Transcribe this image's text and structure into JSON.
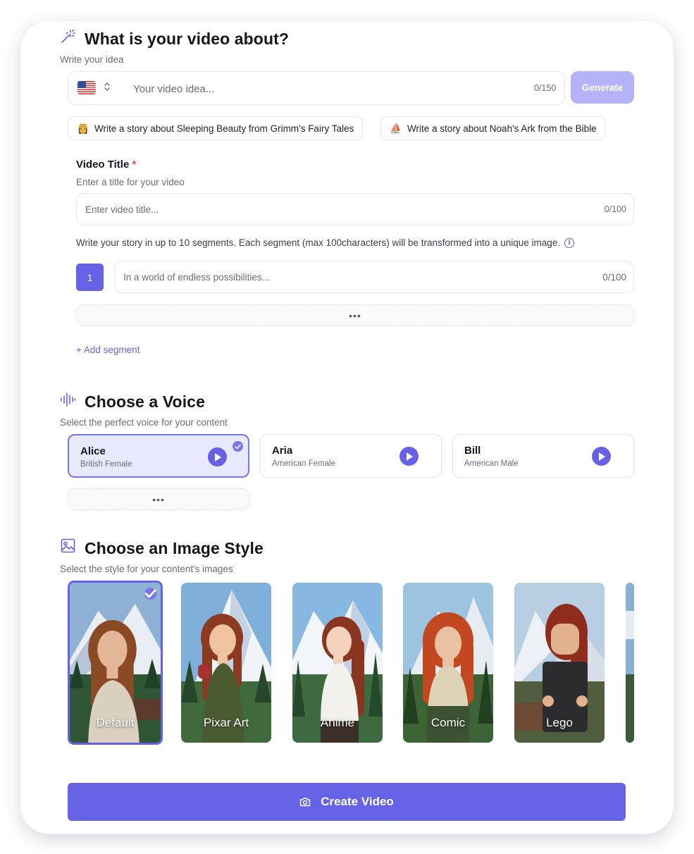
{
  "about": {
    "title": "What is your video about?",
    "subtitle": "Write your idea",
    "language_flag": "us-flag-icon",
    "idea_placeholder": "Your video idea...",
    "idea_counter": "0/150",
    "generate_label": "Generate"
  },
  "suggestions": [
    {
      "emoji": "👸",
      "text": "Write a story about Sleeping Beauty from Grimm's Fairy Tales"
    },
    {
      "emoji": "⛵",
      "text": "Write a story about Noah's Ark from the Bible"
    }
  ],
  "video_title": {
    "label": "Video Title",
    "required_mark": "*",
    "hint": "Enter a title for your video",
    "placeholder": "Enter video title...",
    "counter": "0/100"
  },
  "segments": {
    "description": "Write your story in up to 10 segments. Each segment (max 100characters) will be transformed into a unique image.",
    "items": [
      {
        "number": "1",
        "placeholder": "In a world of endless possibilities...",
        "counter": "0/100"
      }
    ],
    "more_label": "•••",
    "add_label": "+ Add segment"
  },
  "voice": {
    "title": "Choose a Voice",
    "subtitle": "Select the perfect voice for your content",
    "options": [
      {
        "name": "Alice",
        "desc": "British Female",
        "selected": true
      },
      {
        "name": "Aria",
        "desc": "American Female",
        "selected": false
      },
      {
        "name": "Bill",
        "desc": "American Male",
        "selected": false
      }
    ],
    "more_label": "•••"
  },
  "image_style": {
    "title": "Choose an Image Style",
    "subtitle": "Select the style for your content's images",
    "options": [
      {
        "label": "Default",
        "selected": true
      },
      {
        "label": "Pixar Art",
        "selected": false
      },
      {
        "label": "Anime",
        "selected": false
      },
      {
        "label": "Comic",
        "selected": false
      },
      {
        "label": "Lego",
        "selected": false
      }
    ]
  },
  "create_label": "Create Video",
  "colors": {
    "accent": "#6662e6",
    "accent_light": "#e9e9fd",
    "generate_disabled": "#b4b3f7",
    "required": "#e5484d"
  }
}
